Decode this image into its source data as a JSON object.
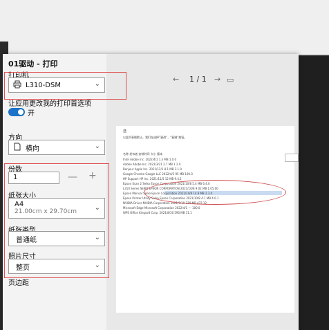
{
  "dialog": {
    "title": "01驱动 - 打印",
    "printer_label": "打印机",
    "printer_value": "L310-DSM",
    "app_pref_text": "让应用更改我的打印首选项",
    "toggle_state": "开",
    "orientation_label": "方向",
    "orientation_value": "横向",
    "copies_label": "份数",
    "copies_value": "1",
    "decrease_symbol": "—",
    "increase_symbol": "+",
    "paper_size_label": "纸张大小",
    "paper_size_value": "A4",
    "paper_size_dims": "21.00cm x 29.70cm",
    "paper_type_label": "纸张类型",
    "paper_type_value": "普通纸",
    "photo_size_label": "照片尺寸",
    "photo_size_value": "整页",
    "cutoff_label": "页边距"
  },
  "preview": {
    "page_indicator": "1 / 1",
    "doc_lines": [
      "选",
      "以此列表格默认，我们在选择“更改”，“复制”按钮。",
      "名称              发布者                        安装时间        大小    版本",
      "Intel             Adobe Inc.                   2022/4/1        1.3 MB   1.0.0",
      "Adobe             Adobe Inc.                   2022/3/21       2.7 MB   1.2.0",
      "Bonjour           Apple Inc.                   2021/12/1       8.1 MB   3.1.0",
      "Google Chrome     Google LLC                   2022/4/2        95 MB    100.0",
      "HP Support        HP Inc.                      2021/11/5       12 MB    9.4.1",
      "Epson Scan 2      Seiko Epson Corporation      2021/10/8       5.4 MB   6.4.0",
      "L310 Series       SEIKO EPSON CORPORATION      2021/10/8       9.02 MB  1.05.00",
      "Epson Manual      Seiko Epson Corporation      2021/10/8       14.8 MB  2.3.0",
      "Epson Printer Utility  Seiko Epson Corporation 2021/10/8       4.1 MB   4.0.1",
      "NVIDIA Driver     NVIDIA Corporation           2021/9/10       330 MB   472.12",
      "Microsoft Edge    Microsoft Corporation        2022/4/1        ---      100.0",
      "WPS Office        Kingsoft Corp.               2021/8/30       590 MB   11.1"
    ]
  }
}
